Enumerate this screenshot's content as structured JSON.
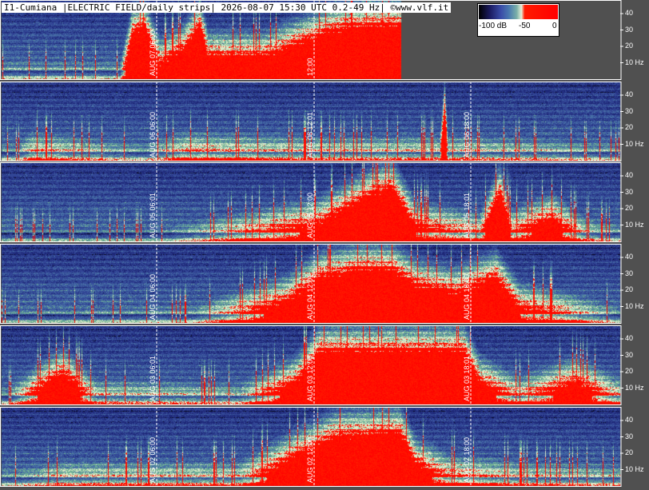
{
  "header": {
    "title": "I1-Cumiana |ELECTRIC FIELD/daily strips| 2026-08-07 15:30 UTC 0.2-49 Hz| ©www.vlf.it"
  },
  "legend": {
    "min_label": "-100 dB",
    "mid_label": "-50",
    "max_label": "0"
  },
  "axis": {
    "freq_ticks": [
      "40",
      "30",
      "20",
      "10 Hz"
    ]
  },
  "colors": {
    "background": "#505050",
    "low": "#2a3a8a",
    "mid": "#7ab0a8",
    "high": "#ff0000",
    "grid": "#ffffff"
  },
  "strips": [
    {
      "date": "AUG 07",
      "labels": [
        "AUG 07 06:00",
        "12:00"
      ],
      "fraction_recorded": 0.646
    },
    {
      "date": "AUG 06",
      "labels": [
        "AUG 06 06:00",
        "AUG 06 12:01",
        "AUG 06 18:00"
      ],
      "fraction_recorded": 1.0
    },
    {
      "date": "AUG 05",
      "labels": [
        "AUG 05 06:01",
        "AUG 05 12:00",
        "AUG 05 18:01"
      ],
      "fraction_recorded": 1.0
    },
    {
      "date": "AUG 04",
      "labels": [
        "AUG 04 06:00",
        "AUG 04 12:01",
        "AUG 04 18:00"
      ],
      "fraction_recorded": 1.0
    },
    {
      "date": "AUG 03",
      "labels": [
        "AUG 03 06:01",
        "AUG 03 12:00",
        "AUG 03 18:01"
      ],
      "fraction_recorded": 1.0
    },
    {
      "date": "AUG 02",
      "labels": [
        "AUG 02 06:00",
        "AUG 02 12:00",
        "AUG 02 18:00"
      ],
      "fraction_recorded": 1.0
    }
  ]
}
